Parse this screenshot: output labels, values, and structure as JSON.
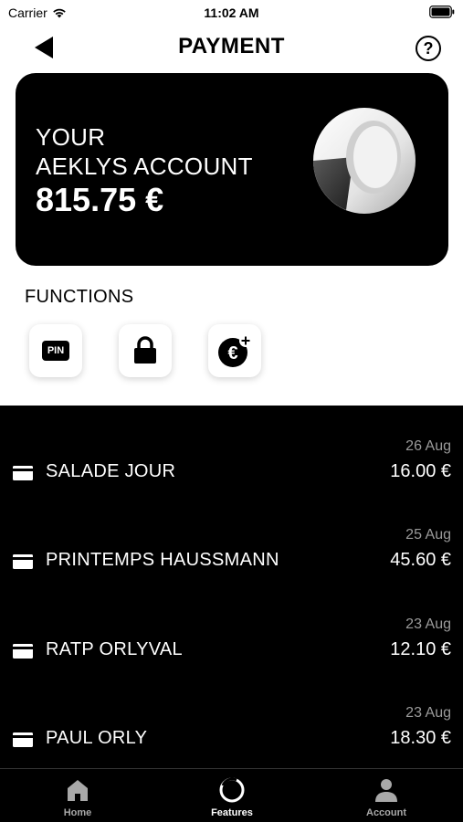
{
  "status_bar": {
    "carrier": "Carrier",
    "time": "11:02 AM"
  },
  "header": {
    "title": "PAYMENT",
    "help_label": "?"
  },
  "account": {
    "line1": "YOUR",
    "line2": "AEKLYS ACCOUNT",
    "balance": "815.75 €"
  },
  "functions": {
    "label": "FUNCTIONS",
    "pin_label": "PIN"
  },
  "transactions": [
    {
      "date": "26 Aug",
      "name": "SALADE JOUR",
      "amount": "16.00 €"
    },
    {
      "date": "25 Aug",
      "name": "PRINTEMPS HAUSSMANN",
      "amount": "45.60 €"
    },
    {
      "date": "23 Aug",
      "name": "RATP ORLYVAL",
      "amount": "12.10 €"
    },
    {
      "date": "23 Aug",
      "name": "PAUL ORLY",
      "amount": "18.30 €"
    }
  ],
  "tabs": [
    {
      "label": "Home",
      "icon": "home-icon"
    },
    {
      "label": "Features",
      "icon": "features-icon",
      "active": true
    },
    {
      "label": "Account",
      "icon": "user-icon"
    }
  ],
  "colors": {
    "background": "#ffffff",
    "card": "#000000",
    "muted": "#9a9a9a"
  }
}
